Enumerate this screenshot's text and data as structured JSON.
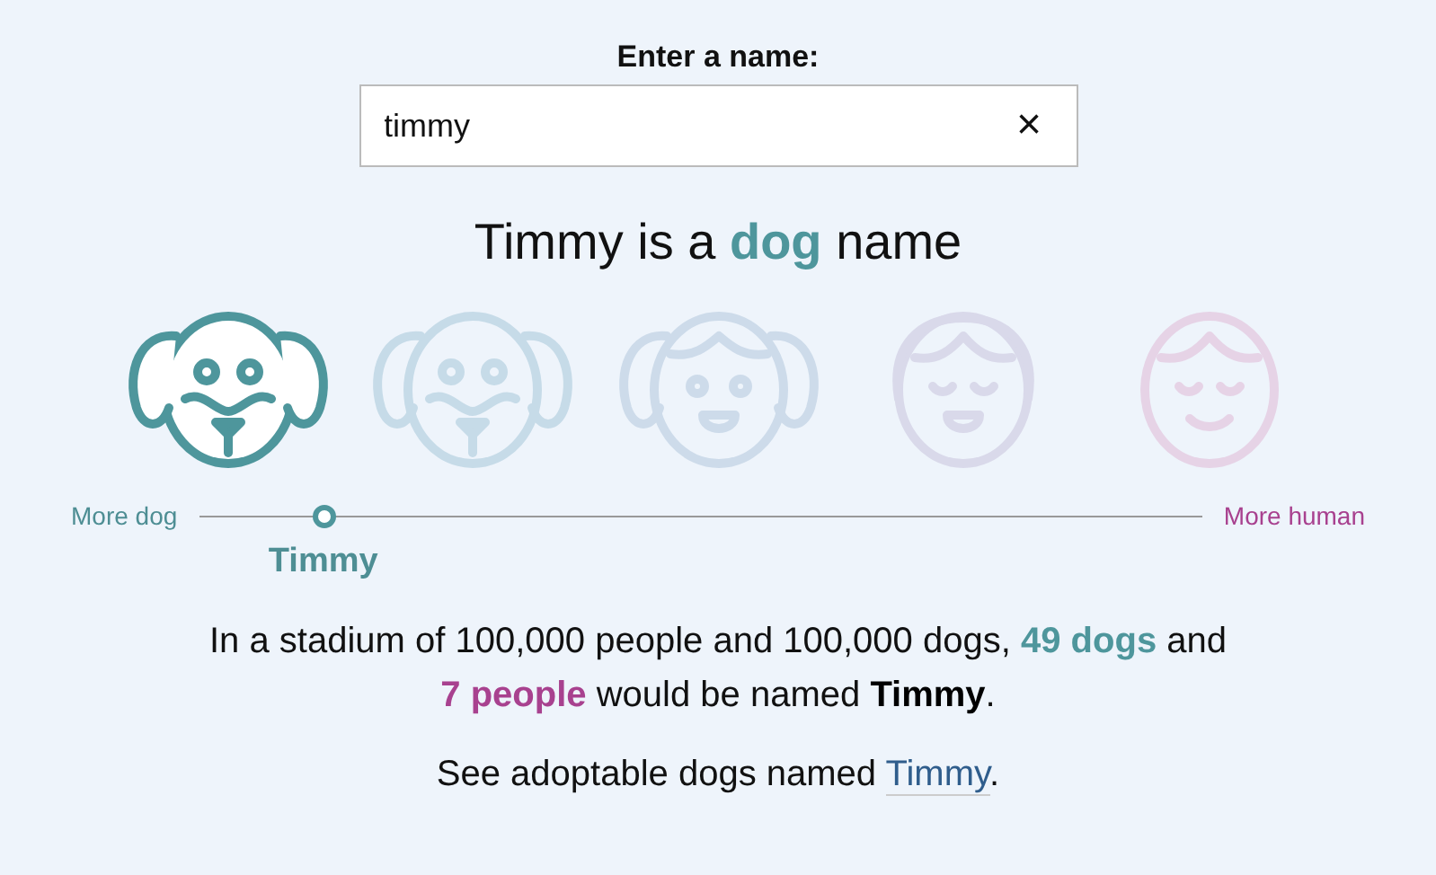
{
  "search": {
    "label": "Enter a name:",
    "value": "timmy",
    "clear": "×"
  },
  "headline": [
    {
      "kind": "plain",
      "text": "Timmy is a"
    },
    {
      "kind": "dog",
      "text": "dog"
    },
    {
      "kind": "plain",
      "text": "name"
    }
  ],
  "faces": [
    {
      "kind": "dog",
      "color": "#4e969c",
      "selected": true
    },
    {
      "kind": "dog",
      "color": "#c6dbe8",
      "selected": false
    },
    {
      "kind": "mix",
      "color": "#cddbea",
      "selected": false
    },
    {
      "kind": "human-hair",
      "color": "#d9d9ea",
      "selected": false
    },
    {
      "kind": "human",
      "color": "#e6d3e6",
      "selected": false
    }
  ],
  "scale": {
    "left": "More dog",
    "right": "More human",
    "level": 0.124,
    "marker_label": "Timmy"
  },
  "stats": [
    {
      "kind": "plain",
      "text": "In a stadium of 100,000 people and 100,000 dogs,"
    },
    {
      "kind": "dog",
      "text": "49 dogs"
    },
    {
      "kind": "plain",
      "text": "and"
    },
    {
      "kind": "human",
      "text": "7 people"
    },
    {
      "kind": "plain",
      "text": "would be named"
    },
    {
      "kind": "bold",
      "text": "Timmy"
    },
    {
      "kind": "tight",
      "text": "."
    }
  ],
  "adopt": {
    "text": "See adoptable dogs named",
    "link": "Timmy",
    "end": "."
  }
}
